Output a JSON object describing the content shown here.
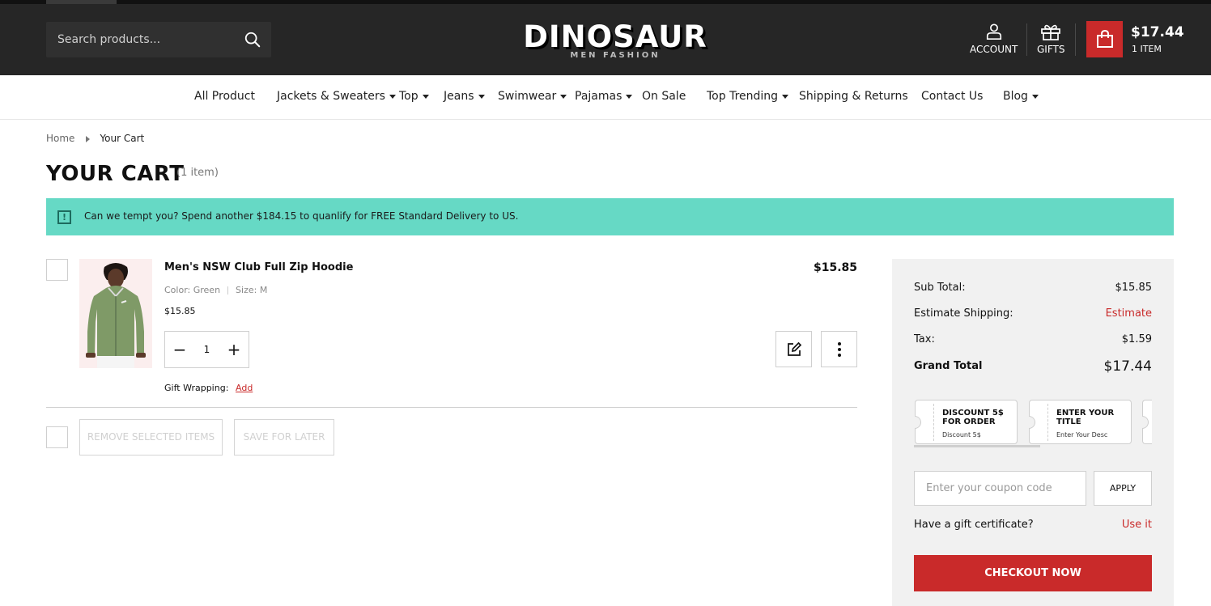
{
  "header": {
    "search_placeholder": "Search products...",
    "logo_main": "DINOSAUR",
    "logo_sub": "MEN FASHION",
    "account_label": "ACCOUNT",
    "gifts_label": "GIFTS",
    "cart_total": "$17.44",
    "cart_count": "1 ITEM"
  },
  "nav": {
    "items": [
      {
        "label": "All Product"
      },
      {
        "label": "Jackets & Sweaters"
      },
      {
        "label": "Top"
      },
      {
        "label": "Jeans"
      },
      {
        "label": "Swimwear"
      },
      {
        "label": "Pajamas"
      },
      {
        "label": "On Sale"
      },
      {
        "label": "Top Trending"
      },
      {
        "label": "Shipping & Returns"
      },
      {
        "label": "Contact Us"
      },
      {
        "label": "Blog"
      }
    ]
  },
  "breadcrumb": {
    "home": "Home",
    "current": "Your Cart"
  },
  "page": {
    "title": "YOUR CART",
    "count": "(1 item)"
  },
  "notice": {
    "icon": "!",
    "text": "Can we tempt you? Spend another $184.15 to quanlify for FREE Standard Delivery to US."
  },
  "item": {
    "name": "Men's NSW Club Full Zip Hoodie",
    "color_label": "Color:",
    "color_value": "Green",
    "size_label": "Size:",
    "size_value": "M",
    "unit_price": "$15.85",
    "total": "$15.85",
    "quantity": "1",
    "minus": "−",
    "plus": "+",
    "gift_label": "Gift Wrapping:",
    "gift_action": "Add",
    "colors": {
      "hoodie": "#7f9a67",
      "background": "#fbeeee"
    }
  },
  "actions": {
    "remove_selected": "REMOVE SELECTED ITEMS",
    "save_later": "SAVE FOR LATER"
  },
  "summary": {
    "subtotal_label": "Sub Total:",
    "subtotal_value": "$15.85",
    "shipping_label": "Estimate Shipping:",
    "shipping_value": "Estimate",
    "tax_label": "Tax:",
    "tax_value": "$1.59",
    "grand_label": "Grand Total",
    "grand_value": "$17.44",
    "coupons": [
      {
        "title": "DISCOUNT 5$ FOR ORDER",
        "desc": "Discount 5$"
      },
      {
        "title": "ENTER YOUR TITLE",
        "desc": "Enter Your Desc"
      }
    ],
    "coupon_placeholder": "Enter your coupon code",
    "apply_label": "APPLY",
    "gift_cert_label": "Have a gift certificate?",
    "gift_cert_link": "Use it",
    "checkout_label": "CHECKOUT NOW"
  },
  "colors": {
    "brand_red": "#c92a2a",
    "header_bg": "#262626",
    "notice_bg": "#66d9c5"
  }
}
